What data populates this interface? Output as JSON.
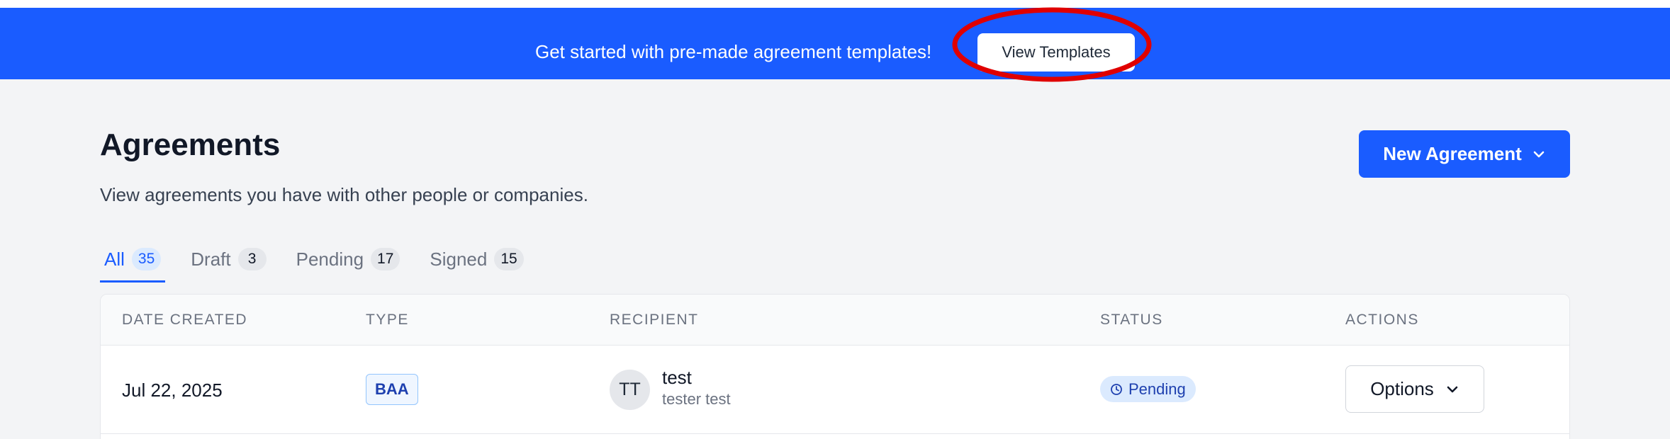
{
  "banner": {
    "text": "Get started with pre-made agreement templates!",
    "button_label": "View Templates"
  },
  "header": {
    "title": "Agreements",
    "subtitle": "View agreements you have with other people or companies.",
    "new_button_label": "New Agreement"
  },
  "tabs": [
    {
      "label": "All",
      "count": "35",
      "active": true
    },
    {
      "label": "Draft",
      "count": "3",
      "active": false
    },
    {
      "label": "Pending",
      "count": "17",
      "active": false
    },
    {
      "label": "Signed",
      "count": "15",
      "active": false
    }
  ],
  "table": {
    "columns": [
      "DATE CREATED",
      "TYPE",
      "RECIPIENT",
      "STATUS",
      "ACTIONS"
    ],
    "rows": [
      {
        "date": "Jul 22, 2025",
        "type": "BAA",
        "recipient_initials": "TT",
        "recipient_name": "test",
        "recipient_sub": "tester test",
        "status": "Pending",
        "action_label": "Options"
      }
    ]
  },
  "icons": {
    "new_agreement_dropdown": "chevron-down-icon",
    "status": "clock-icon",
    "options_dropdown": "chevron-down-icon"
  },
  "colors": {
    "primary": "#1a5cff",
    "page_background": "#f3f4f6",
    "highlight": "#e00000"
  }
}
